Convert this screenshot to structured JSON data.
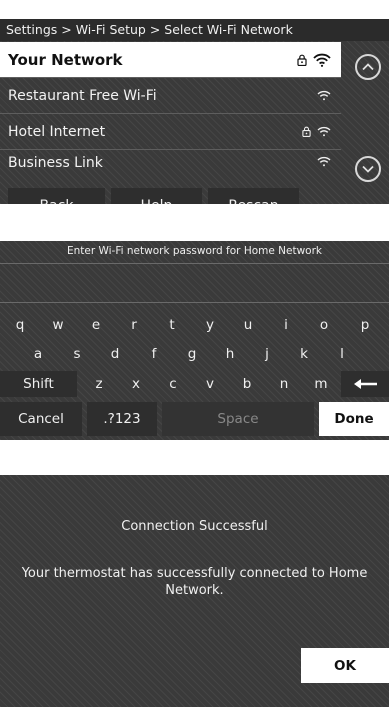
{
  "wifi_select": {
    "breadcrumb": "Settings > Wi-Fi Setup > Select Wi-Fi Network",
    "networks": [
      {
        "name": "Your Network",
        "locked": true,
        "selected": true,
        "icon": "wifi-strong-icon"
      },
      {
        "name": "Restaurant Free Wi-Fi",
        "locked": false,
        "selected": false,
        "icon": "wifi-icon"
      },
      {
        "name": "Hotel Internet",
        "locked": true,
        "selected": false,
        "icon": "wifi-icon"
      },
      {
        "name": "Business Link",
        "locked": false,
        "selected": false,
        "icon": "wifi-icon"
      }
    ],
    "scroll_up_icon": "chevron-up-icon",
    "scroll_down_icon": "chevron-down-icon",
    "buttons": {
      "back": "Back",
      "help": "Help",
      "rescan": "Rescan"
    }
  },
  "password_entry": {
    "title": "Enter Wi-Fi network password for Home Network",
    "value": "",
    "rows": [
      [
        "q",
        "w",
        "e",
        "r",
        "t",
        "y",
        "u",
        "i",
        "o",
        "p"
      ],
      [
        "a",
        "s",
        "d",
        "f",
        "g",
        "h",
        "j",
        "k",
        "l"
      ],
      [
        "z",
        "x",
        "c",
        "v",
        "b",
        "n",
        "m"
      ]
    ],
    "shift": "Shift",
    "backspace_icon": "backspace-arrow-icon",
    "cancel": "Cancel",
    "symbols": ".?123",
    "space": "Space",
    "done": "Done"
  },
  "connection_result": {
    "title": "Connection Successful",
    "message": "Your thermostat has successfully connected to Home Network.",
    "ok": "OK"
  },
  "colors": {
    "panel": "#3a3a3a",
    "selected_row": "#ffffff",
    "text": "#f2f2f2",
    "button_dark": "#2e2e2e"
  }
}
